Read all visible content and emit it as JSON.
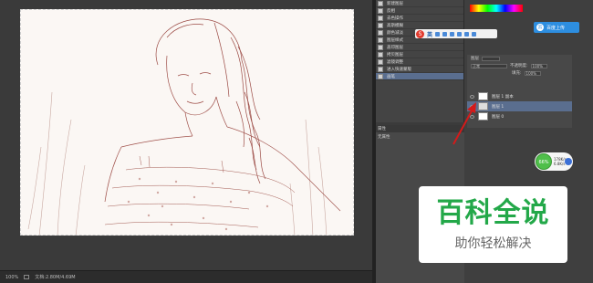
{
  "history": {
    "items": [
      {
        "label": "新建图层",
        "selected": false
      },
      {
        "label": "反相",
        "selected": false
      },
      {
        "label": "去色操作",
        "selected": false
      },
      {
        "label": "高斯模糊",
        "selected": false
      },
      {
        "label": "颜色减淡",
        "selected": false
      },
      {
        "label": "图层样式",
        "selected": false
      },
      {
        "label": "盖印图层",
        "selected": false
      },
      {
        "label": "拷贝图层",
        "selected": false
      },
      {
        "label": "滤镜调整",
        "selected": false
      },
      {
        "label": "进入快速蒙版",
        "selected": false
      },
      {
        "label": "画笔",
        "selected": true
      }
    ]
  },
  "properties": {
    "tab": "属性",
    "content": "无属性"
  },
  "ime": {
    "logo": "S",
    "mode": "英"
  },
  "baidu_upload": {
    "label": "百度上传",
    "logo": "云"
  },
  "layers": {
    "tab": "图层",
    "blend_mode": "正常",
    "opacity_label": "不透明度:",
    "opacity_value": "100%",
    "fill_label": "填充:",
    "fill_value": "100%",
    "items": [
      {
        "name": "图层 1 副本",
        "selected": false
      },
      {
        "name": "图层 1",
        "selected": true
      },
      {
        "name": "图层 0",
        "selected": false
      }
    ]
  },
  "speed_widget": {
    "percent": "66%",
    "up": "178K/s",
    "down": "6.8K/s"
  },
  "status": {
    "zoom": "100%",
    "doc": "文档:2.80M/4.69M"
  },
  "watermark": {
    "title": "百科全说",
    "subtitle": "助你轻松解决"
  },
  "colors": {
    "accent_green": "#23a849",
    "selection_blue": "#5a6e8f",
    "arrow_red": "#d41a1a"
  }
}
